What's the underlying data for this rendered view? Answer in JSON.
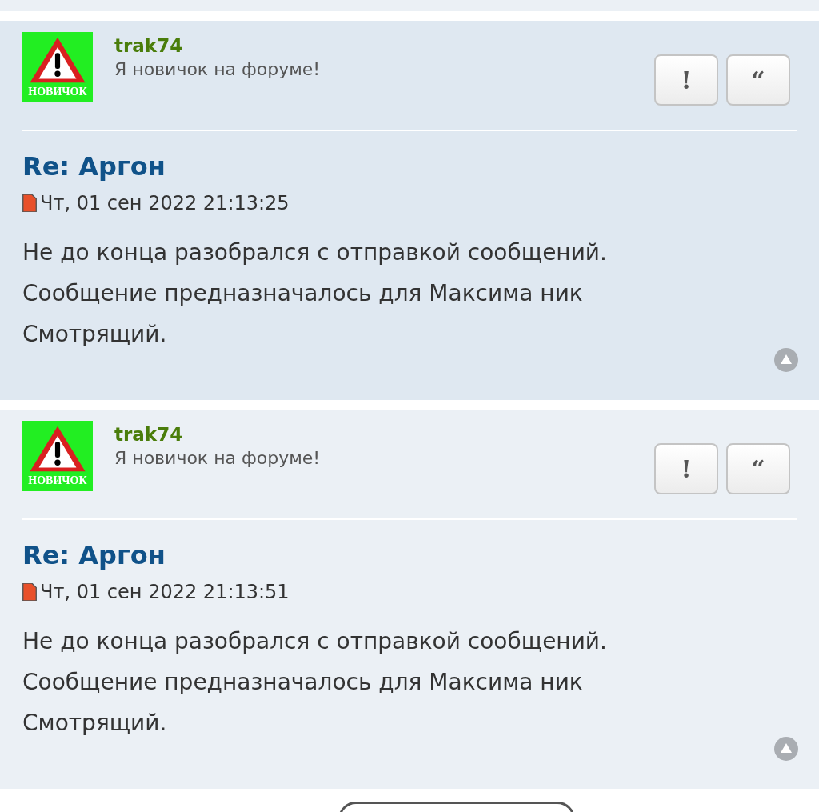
{
  "posts": [
    {
      "author": "trak74",
      "rank_text": "Я новичок на форуме!",
      "rank_badge": "НОВИЧОК",
      "buttons": [
        "!",
        "“"
      ],
      "title": "Re: Аргон",
      "date": "Чт, 01 сен 2022 21:13:25",
      "body": "Не до конца разобрался с отправкой сообщений. Сообщение предназначалось для Максима ник Смотрящий."
    },
    {
      "author": "trak74",
      "rank_text": "Я новичок на форуме!",
      "rank_badge": "НОВИЧОК",
      "buttons": [
        "!",
        "“"
      ],
      "title": "Re: Аргон",
      "date": "Чт, 01 сен 2022 21:13:51",
      "body": "Не до конца разобрался с отправкой сообщений. Сообщение предназначалось для Максима ник Смотрящий."
    }
  ]
}
